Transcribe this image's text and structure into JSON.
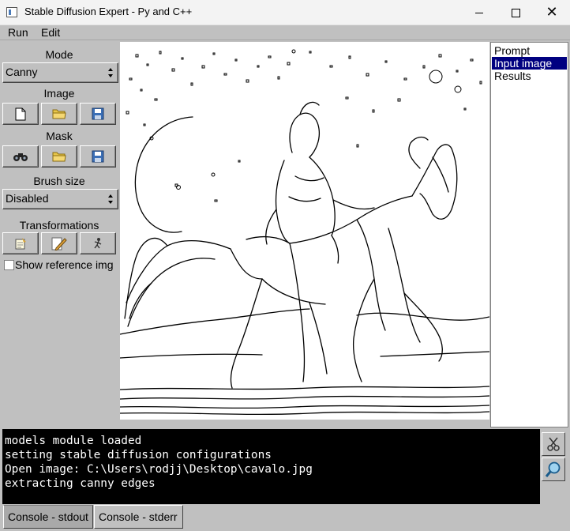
{
  "window": {
    "title": "Stable Diffusion Expert - Py and C++"
  },
  "menu": [
    {
      "label": "Run"
    },
    {
      "label": "Edit"
    }
  ],
  "left_panel": {
    "mode": {
      "label": "Mode",
      "value": "Canny"
    },
    "image": {
      "label": "Image",
      "buttons": [
        "new-file-icon",
        "open-folder-icon",
        "save-disk-icon"
      ]
    },
    "mask": {
      "label": "Mask",
      "buttons": [
        "binoculars-icon",
        "open-folder-icon",
        "save-disk-icon"
      ]
    },
    "brush_size": {
      "label": "Brush size",
      "value": "Disabled"
    },
    "transformations": {
      "label": "Transformations",
      "buttons": [
        "notepad-icon",
        "pencil-icon",
        "figure-icon"
      ]
    },
    "show_reference": {
      "label": "Show reference img",
      "checked": false
    }
  },
  "right_panel": {
    "items": [
      {
        "label": "Prompt",
        "selected": false
      },
      {
        "label": "Input image",
        "selected": true
      },
      {
        "label": "Results",
        "selected": false
      }
    ]
  },
  "console": {
    "lines": [
      "models module loaded",
      "setting stable diffusion configurations",
      "Open image: C:\\Users\\rodjj\\Desktop\\cavalo.jpg",
      "extracting canny edges"
    ],
    "tools": [
      "scissors-icon",
      "magnifier-icon"
    ]
  },
  "tabs": [
    {
      "label": "Console - stdout",
      "active": true
    },
    {
      "label": "Console - stderr",
      "active": false
    }
  ],
  "colors": {
    "chrome": "#c0c0c0",
    "selection": "#000080",
    "console_bg": "#000000",
    "console_fg": "#ffffff"
  }
}
